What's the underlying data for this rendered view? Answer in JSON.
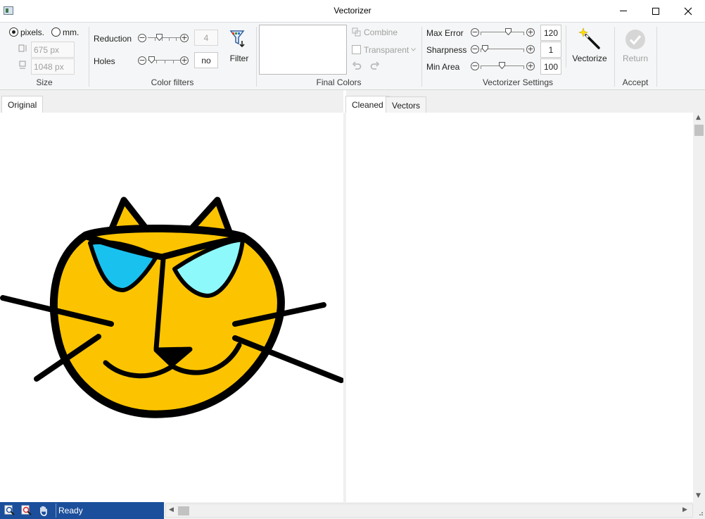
{
  "window": {
    "title": "Vectorizer"
  },
  "ribbon": {
    "size": {
      "label": "Size",
      "unit_pixels": "pixels.",
      "unit_mm": "mm.",
      "selected_unit": "pixels.",
      "width": "675 px",
      "height": "1048 px"
    },
    "color_filters": {
      "label": "Color filters",
      "reduction_label": "Reduction",
      "reduction_value": "4",
      "reduction_level": 0.3,
      "holes_label": "Holes",
      "holes_value": "no",
      "holes_level": 0.1,
      "filter_label": "Filter",
      "filter_icon": "funnel-filter-icon"
    },
    "final_colors": {
      "label": "Final Colors",
      "combine_label": "Combine",
      "transparent_label": "Transparent",
      "undo_icon": "undo-icon",
      "redo_icon": "redo-icon"
    },
    "vectorizer_settings": {
      "label": "Vectorizer Settings",
      "max_error_label": "Max Error",
      "max_error_value": "120",
      "max_error_level": 0.65,
      "sharpness_label": "Sharpness",
      "sharpness_value": "1",
      "sharpness_level": 0.1,
      "min_area_label": "Min Area",
      "min_area_value": "100",
      "min_area_level": 0.5,
      "vectorize_label": "Vectorize",
      "vectorize_icon": "magic-wand-icon"
    },
    "accept": {
      "label": "Accept",
      "return_label": "Return",
      "return_icon": "checkmark-circle-icon"
    }
  },
  "panels": {
    "left_tab": "Original",
    "right_tabs": [
      "Cleaned",
      "Vectors"
    ],
    "active_right_tab": "Cleaned"
  },
  "status": {
    "text": "Ready",
    "icons": [
      "zoom-icon",
      "zoom-fit-icon",
      "pan-hand-icon"
    ]
  },
  "colors": {
    "status_bar": "#1b4f9c",
    "cat_fill": "#fcc400",
    "left_lens": "#19c1ef",
    "right_lens": "#8ef9fa",
    "outline": "#000000"
  }
}
